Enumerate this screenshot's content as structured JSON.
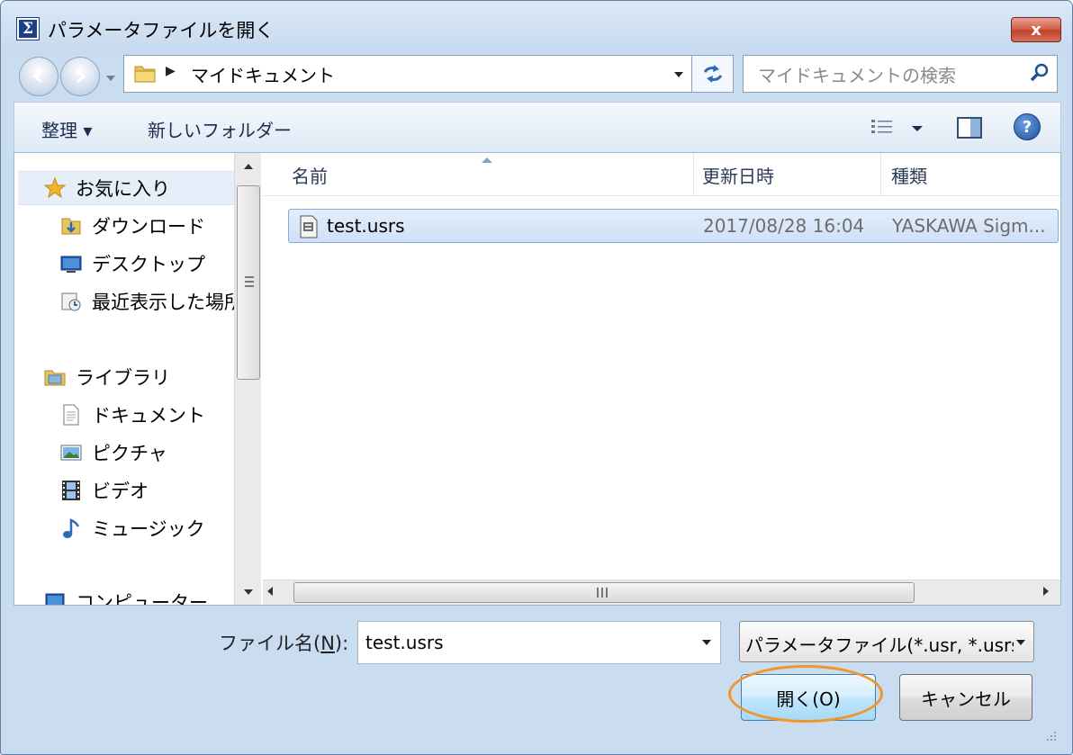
{
  "window": {
    "title": "パラメータファイルを開く",
    "close_label": "x"
  },
  "address": {
    "path": "マイドキュメント"
  },
  "search": {
    "placeholder": "マイドキュメントの検索"
  },
  "toolbar": {
    "organize": "整理 ▾",
    "new_folder": "新しいフォルダー"
  },
  "nav": {
    "favorites": "お気に入り",
    "downloads": "ダウンロード",
    "desktop": "デスクトップ",
    "recent": "最近表示した場所",
    "libraries": "ライブラリ",
    "documents": "ドキュメント",
    "pictures": "ピクチャ",
    "videos": "ビデオ",
    "music": "ミュージック",
    "computer": "コンピューター"
  },
  "columns": {
    "name": "名前",
    "modified": "更新日時",
    "type": "種類"
  },
  "files": [
    {
      "name": "test.usrs",
      "modified": "2017/08/28 16:04",
      "type": "YASKAWA Sigm..."
    }
  ],
  "footer": {
    "filename_label_prefix": "ファイル名(",
    "filename_label_key": "N",
    "filename_label_suffix": "):",
    "filename_value": "test.usrs",
    "filetype_value": "パラメータファイル(*.usr, *.usrs)",
    "open_label": "開く(O)",
    "cancel_label": "キャンセル"
  },
  "colors": {
    "highlight": "#f0962a",
    "selection": "#cfe0f7",
    "window_frame": "#c9dcf0"
  }
}
